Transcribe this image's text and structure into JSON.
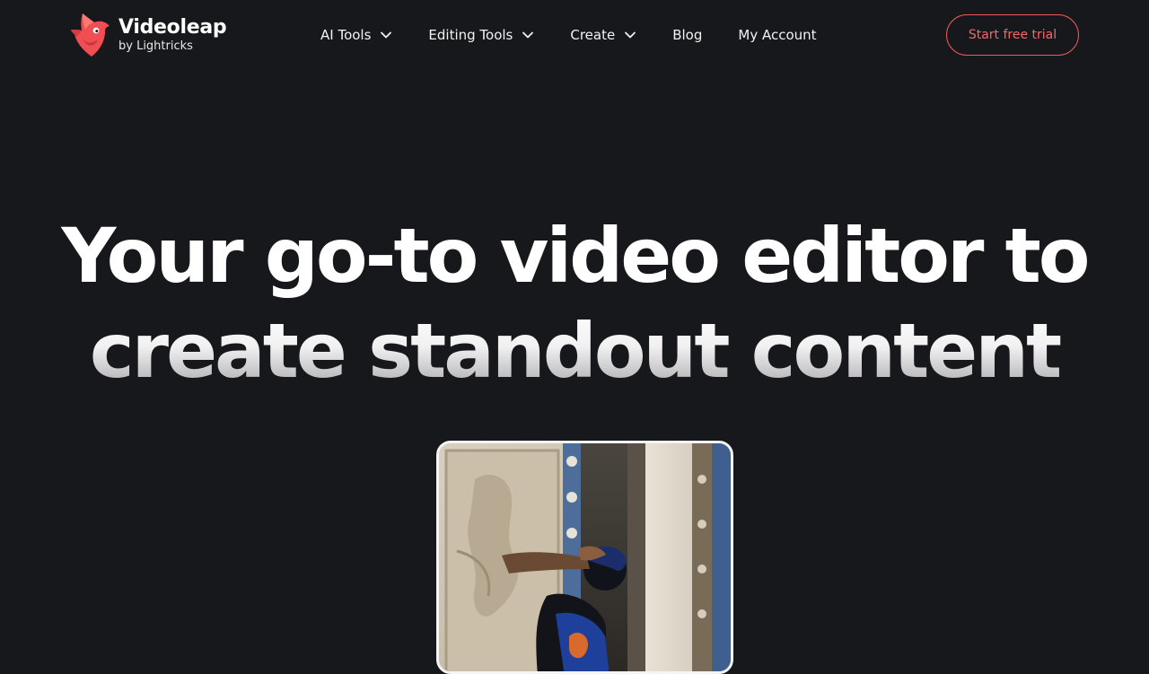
{
  "brand": {
    "name": "Videoleap",
    "tagline": "by Lightricks",
    "accent_color": "#f0585c"
  },
  "nav": {
    "items": [
      {
        "label": "AI Tools",
        "dropdown": true
      },
      {
        "label": "Editing Tools",
        "dropdown": true
      },
      {
        "label": "Create",
        "dropdown": true
      },
      {
        "label": "Blog",
        "dropdown": false
      },
      {
        "label": "My Account",
        "dropdown": false
      }
    ]
  },
  "cta": {
    "label": "Start free trial"
  },
  "hero": {
    "title_line1": "Your go-to video editor to",
    "title_line2": "create standout content"
  },
  "icons": {
    "logo": "bird-logo-icon",
    "dropdown": "chevron-down-icon"
  }
}
